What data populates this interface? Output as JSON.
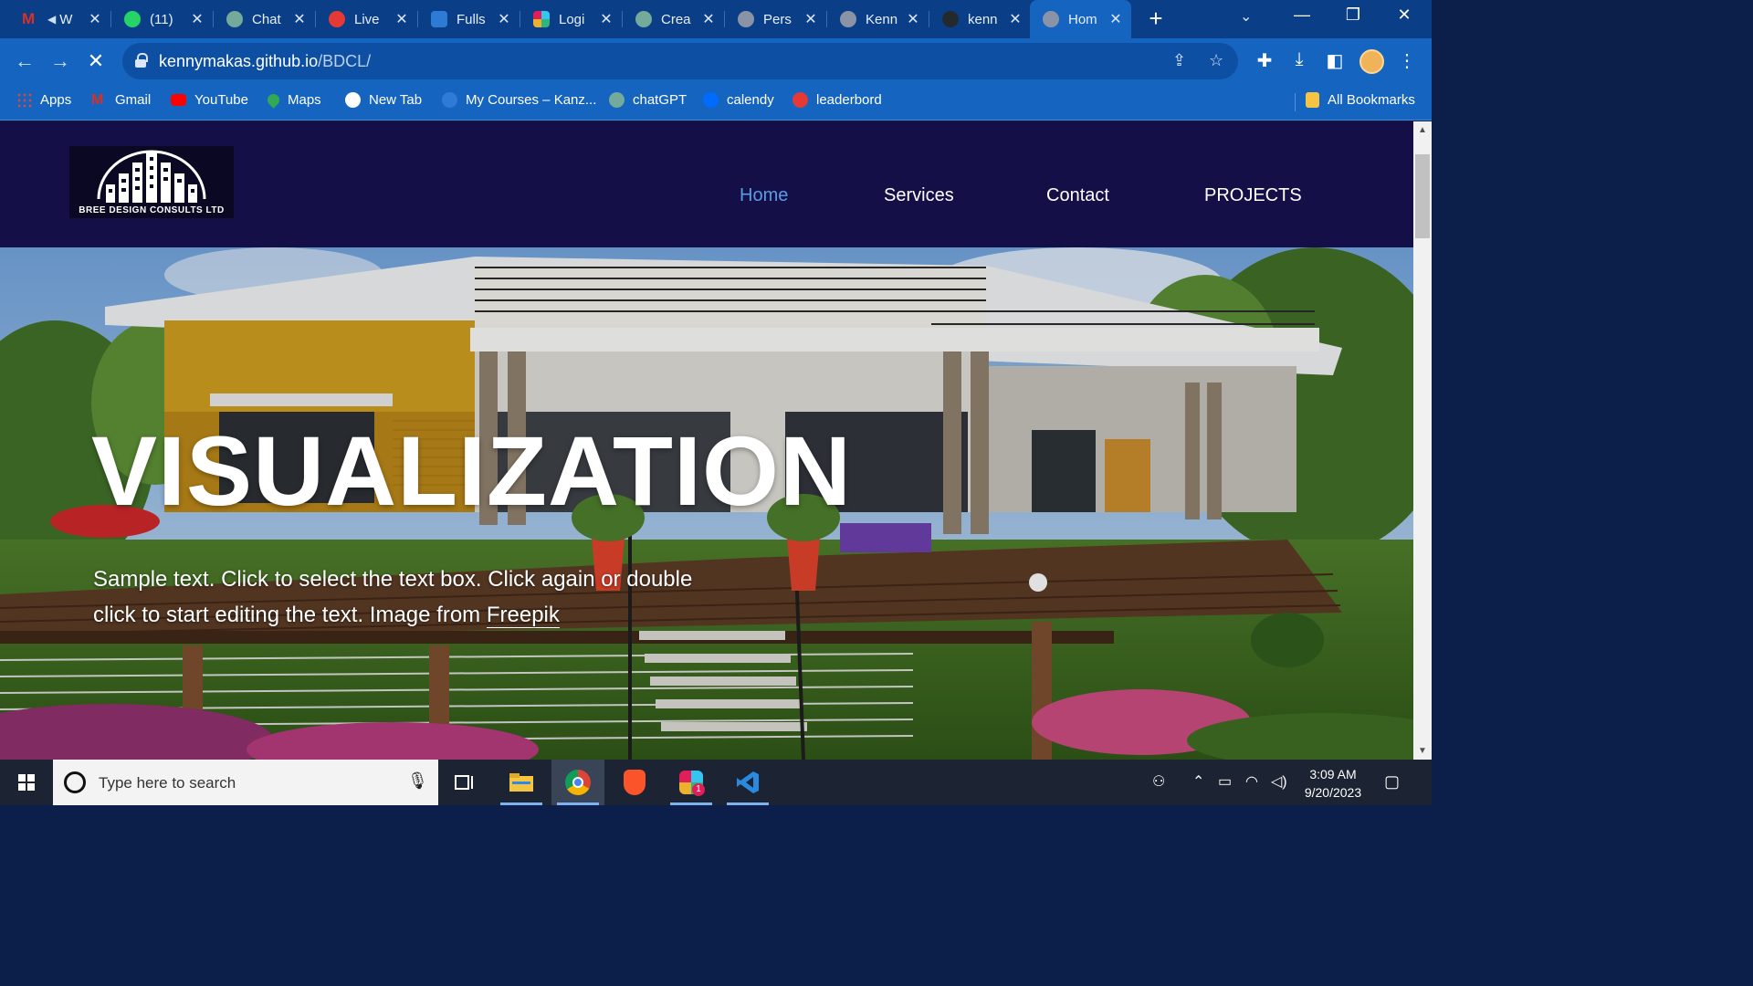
{
  "browser": {
    "tabs": [
      {
        "title": "W",
        "favicon": "gmail-icon",
        "color": "#d93025"
      },
      {
        "title": "(11)",
        "favicon": "whatsapp-icon",
        "color": "#25d366"
      },
      {
        "title": "Chat",
        "favicon": "chatgpt-icon",
        "color": "#74aa9c"
      },
      {
        "title": "Live",
        "favicon": "live-icon",
        "color": "#e53935"
      },
      {
        "title": "Fulls",
        "favicon": "kanzu-icon",
        "color": "#2e7bd6"
      },
      {
        "title": "Logi",
        "favicon": "slack-icon",
        "color": "#e01e5a"
      },
      {
        "title": "Crea",
        "favicon": "chatgpt-icon",
        "color": "#74aa9c"
      },
      {
        "title": "Pers",
        "favicon": "globe-icon",
        "color": "#8a94a6"
      },
      {
        "title": "Kenn",
        "favicon": "globe-icon",
        "color": "#8a94a6"
      },
      {
        "title": "kenn",
        "favicon": "github-icon",
        "color": "#24292e"
      },
      {
        "title": "Hom",
        "favicon": "globe-icon",
        "color": "#8a94a6"
      }
    ],
    "address": {
      "domain": "kennymakas.github.io",
      "path": "/BDCL/"
    },
    "bookmarks": [
      {
        "label": "Apps",
        "icon": "apps-grid-icon",
        "color": "#ea4335"
      },
      {
        "label": "Gmail",
        "icon": "gmail-icon",
        "color": "#d93025"
      },
      {
        "label": "YouTube",
        "icon": "youtube-icon",
        "color": "#ff0000"
      },
      {
        "label": "Maps",
        "icon": "maps-icon",
        "color": "#34a853"
      },
      {
        "label": "New Tab",
        "icon": "globe-icon",
        "color": "#ffffff"
      },
      {
        "label": "My Courses – Kanz...",
        "icon": "kanzu-icon",
        "color": "#2e7bd6"
      },
      {
        "label": "chatGPT",
        "icon": "chatgpt-icon",
        "color": "#74aa9c"
      },
      {
        "label": "calendy",
        "icon": "calendly-icon",
        "color": "#006bff"
      },
      {
        "label": "leaderbord",
        "icon": "leaderboard-icon",
        "color": "#e53935"
      }
    ],
    "all_bookmarks": "All Bookmarks"
  },
  "site": {
    "logo_text": "BREE DESIGN CONSULTS LTD",
    "logo_mark": "BDCL",
    "nav": [
      {
        "label": "Home",
        "active": true
      },
      {
        "label": "Services",
        "active": false
      },
      {
        "label": "Contact",
        "active": false
      },
      {
        "label": "PROJECTS",
        "active": false
      }
    ],
    "hero": {
      "title": "VISUALIZATION",
      "text_prefix": "Sample text. Click to select the text box. Click again or double click to start editing the text. Image from ",
      "link_text": "Freepik"
    }
  },
  "taskbar": {
    "search_placeholder": "Type here to search",
    "time": "3:09 AM",
    "date": "9/20/2023",
    "slack_badge": "1"
  }
}
